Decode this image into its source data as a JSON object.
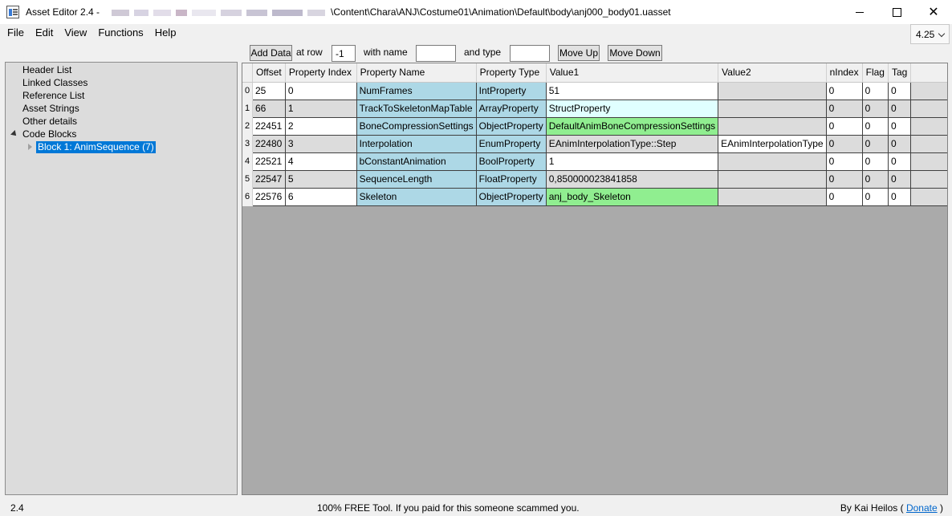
{
  "titlebar": {
    "title_prefix": "Asset Editor 2.4 -",
    "title_path": "\\Content\\Chara\\ANJ\\Costume01\\Animation\\Default\\body\\anj000_body01.uasset",
    "minimize": "",
    "maximize": "",
    "close": "✕"
  },
  "menu": {
    "items": [
      "File",
      "Edit",
      "View",
      "Functions",
      "Help"
    ],
    "version": "4.25"
  },
  "tree": {
    "items": [
      "Header List",
      "Linked Classes",
      "Reference List",
      "Asset Strings",
      "Other details",
      "Code Blocks"
    ],
    "child": "Block 1: AnimSequence  (7)"
  },
  "toolbar": {
    "add_data": "Add Data",
    "at_row": "at row",
    "row_value": "-1",
    "with_name": "with name",
    "name_value": "",
    "and_type": "and type",
    "type_value": "",
    "move_up": "Move Up",
    "move_down": "Move Down"
  },
  "grid": {
    "columns": [
      "Offset",
      "Property Index",
      "Property Name",
      "Property Type",
      "Value1",
      "Value2",
      "nIndex",
      "Flag",
      "Tag"
    ],
    "rows": [
      {
        "row": "0",
        "offset": "25",
        "index": "0",
        "name": "NumFrames",
        "type": "IntProperty",
        "value1": "51",
        "value2": "",
        "nindex": "0",
        "flag": "0",
        "tag": "0"
      },
      {
        "row": "1",
        "offset": "66",
        "index": "1",
        "name": "TrackToSkeletonMapTable",
        "type": "ArrayProperty",
        "value1": "StructProperty",
        "value2": "",
        "nindex": "0",
        "flag": "0",
        "tag": "0"
      },
      {
        "row": "2",
        "offset": "22451",
        "index": "2",
        "name": "BoneCompressionSettings",
        "type": "ObjectProperty",
        "value1": "DefaultAnimBoneCompressionSettings",
        "value2": "",
        "nindex": "0",
        "flag": "0",
        "tag": "0"
      },
      {
        "row": "3",
        "offset": "22480",
        "index": "3",
        "name": "Interpolation",
        "type": "EnumProperty",
        "value1": "EAnimInterpolationType::Step",
        "value2": "EAnimInterpolationType",
        "nindex": "0",
        "flag": "0",
        "tag": "0"
      },
      {
        "row": "4",
        "offset": "22521",
        "index": "4",
        "name": "bConstantAnimation",
        "type": "BoolProperty",
        "value1": "1",
        "value2": "",
        "nindex": "0",
        "flag": "0",
        "tag": "0"
      },
      {
        "row": "5",
        "offset": "22547",
        "index": "5",
        "name": "SequenceLength",
        "type": "FloatProperty",
        "value1": "0,850000023841858",
        "value2": "",
        "nindex": "0",
        "flag": "0",
        "tag": "0"
      },
      {
        "row": "6",
        "offset": "22576",
        "index": "6",
        "name": "Skeleton",
        "type": "ObjectProperty",
        "value1": "anj_body_Skeleton",
        "value2": "",
        "nindex": "0",
        "flag": "0",
        "tag": "0"
      }
    ]
  },
  "status": {
    "version": "2.4",
    "message": "100% FREE Tool. If you paid for this someone scammed you.",
    "author_prefix": "By Kai Heilos (",
    "donate": "Donate",
    "author_suffix": ")"
  },
  "colors": {
    "name_cell": "#add8e6",
    "value_struct": "#e0ffff",
    "value_object": "#90ee90",
    "selected": "#0078d7"
  }
}
